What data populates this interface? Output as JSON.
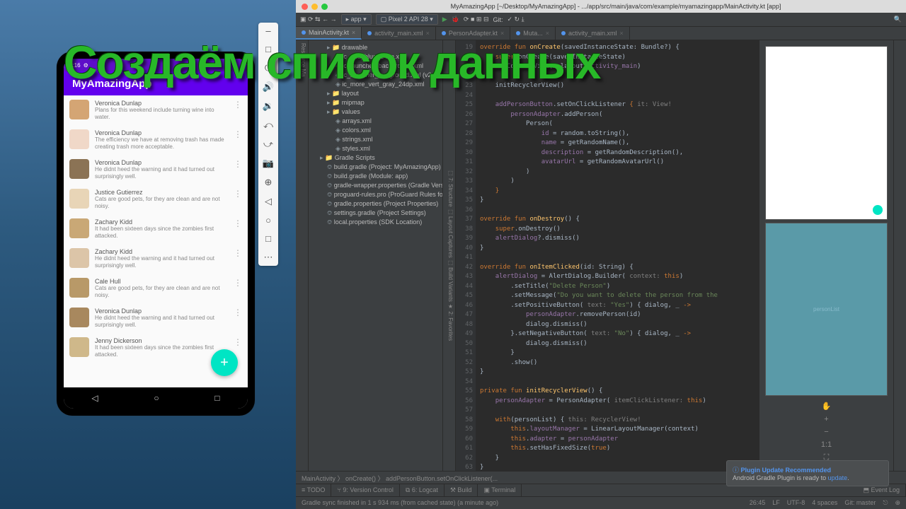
{
  "overlay_title": "Создаём список данных",
  "phone": {
    "time": "1:16",
    "app_name": "MyAmazingApp",
    "contacts": [
      {
        "name": "Veronica Dunlap",
        "desc": "Plans for this weekend include turning wine into water."
      },
      {
        "name": "Veronica Dunlap",
        "desc": "The efficiency we have at removing trash has made creating trash more acceptable."
      },
      {
        "name": "Veronica Dunlap",
        "desc": "He didnt heed the warning and it had turned out surprisingly well."
      },
      {
        "name": "Justice Gutierrez",
        "desc": "Cats are good pets, for they are clean and are not noisy."
      },
      {
        "name": "Zachary Kidd",
        "desc": "It had been sixteen days since the zombies first attacked."
      },
      {
        "name": "Zachary Kidd",
        "desc": "He didnt heed the warning and it had turned out surprisingly well."
      },
      {
        "name": "Cale Hull",
        "desc": "Cats are good pets, for they are clean and are not noisy."
      },
      {
        "name": "Veronica Dunlap",
        "desc": "He didnt heed the warning and it had turned out surprisingly well."
      },
      {
        "name": "Jenny Dickerson",
        "desc": "It had been sixteen days since the zombies first attacked."
      }
    ]
  },
  "ide": {
    "title": "MyAmazingApp [~/Desktop/MyAmazingApp] - .../app/src/main/java/com/example/myamazingapp/MainActivity.kt [app]",
    "toolbar": {
      "module": "app",
      "device": "Pixel 2 API 28",
      "git": "Git:"
    },
    "tabs": [
      {
        "label": "MainActivity.kt",
        "active": true
      },
      {
        "label": "activity_main.xml",
        "active": false
      },
      {
        "label": "PersonAdapter.kt",
        "active": false
      },
      {
        "label": "Muta...",
        "active": false
      },
      {
        "label": "activity_main.xml",
        "active": false
      }
    ],
    "tree": {
      "root": "drawable",
      "items": [
        {
          "label": "drawable",
          "lvl": 2,
          "icon": "folder"
        },
        {
          "label": "ic_add_blue_24dp.xml",
          "lvl": 3,
          "icon": "xml"
        },
        {
          "label": "ic_launcher_background.xml",
          "lvl": 3,
          "icon": "xml"
        },
        {
          "label": "ic_launcher_foreground.xml (v24)",
          "lvl": 3,
          "icon": "xml"
        },
        {
          "label": "ic_more_vert_gray_24dp.xml",
          "lvl": 3,
          "icon": "xml"
        },
        {
          "label": "layout",
          "lvl": 2,
          "icon": "folder"
        },
        {
          "label": "mipmap",
          "lvl": 2,
          "icon": "folder"
        },
        {
          "label": "values",
          "lvl": 2,
          "icon": "folder"
        },
        {
          "label": "arrays.xml",
          "lvl": 3,
          "icon": "xml"
        },
        {
          "label": "colors.xml",
          "lvl": 3,
          "icon": "xml"
        },
        {
          "label": "strings.xml",
          "lvl": 3,
          "icon": "xml"
        },
        {
          "label": "styles.xml",
          "lvl": 3,
          "icon": "xml"
        },
        {
          "label": "Gradle Scripts",
          "lvl": 1,
          "icon": "folder"
        },
        {
          "label": "build.gradle (Project: MyAmazingApp)",
          "lvl": 2,
          "icon": "gradle"
        },
        {
          "label": "build.gradle (Module: app)",
          "lvl": 2,
          "icon": "gradle"
        },
        {
          "label": "gradle-wrapper.properties (Gradle Vers",
          "lvl": 2,
          "icon": "gradle"
        },
        {
          "label": "proguard-rules.pro (ProGuard Rules for",
          "lvl": 2,
          "icon": "gradle"
        },
        {
          "label": "gradle.properties (Project Properties)",
          "lvl": 2,
          "icon": "gradle"
        },
        {
          "label": "settings.gradle (Project Settings)",
          "lvl": 2,
          "icon": "gradle"
        },
        {
          "label": "local.properties (SDK Location)",
          "lvl": 2,
          "icon": "gradle"
        }
      ]
    },
    "code_start_line": 19,
    "breadcrumb": "MainActivity 〉 onCreate() 〉 addPersonButton.setOnClickListener(...",
    "bottom_tabs": [
      "≡ TODO",
      "⑂ 9: Version Control",
      "⧉ 6: Logcat",
      "⚒ Build",
      "▣ Terminal"
    ],
    "event_log": "⬒ Event Log",
    "status": {
      "left": "Gradle sync finished in 1 s 934 ms (from cached state) (a minute ago)",
      "right": [
        "26:45",
        "LF",
        "UTF-8",
        "4 spaces",
        "Git: master",
        "⎋",
        "⊕"
      ]
    },
    "notif": {
      "title": "Plugin Update Recommended",
      "body": "Android Gradle Plugin is ready to",
      "link": "update"
    }
  }
}
